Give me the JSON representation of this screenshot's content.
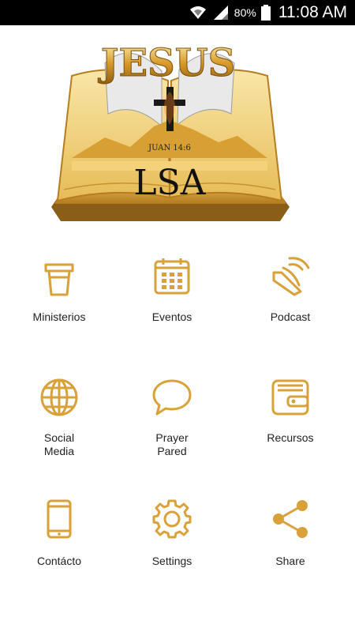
{
  "status_bar": {
    "battery_percent": "80%",
    "time": "11:08 AM",
    "icons": [
      "wifi-icon",
      "signal-icon",
      "battery-icon"
    ]
  },
  "logo": {
    "title": "JESUS",
    "verse": "JUAN 14:6",
    "initials": "LSA"
  },
  "accent_color": "#d9a13a",
  "menu": [
    {
      "label": "Ministerios",
      "icon": "coffee-cup-icon"
    },
    {
      "label": "Eventos",
      "icon": "calendar-icon"
    },
    {
      "label": "Podcast",
      "icon": "speaker-icon"
    },
    {
      "label_line1": "Social",
      "label_line2": "Media",
      "icon": "globe-icon"
    },
    {
      "label_line1": "Prayer",
      "label_line2": "Pared",
      "icon": "chat-bubble-icon"
    },
    {
      "label": "Recursos",
      "icon": "wallet-icon"
    },
    {
      "label": "Contácto",
      "icon": "phone-icon"
    },
    {
      "label": "Settings",
      "icon": "gear-icon"
    },
    {
      "label": "Share",
      "icon": "share-icon"
    }
  ]
}
